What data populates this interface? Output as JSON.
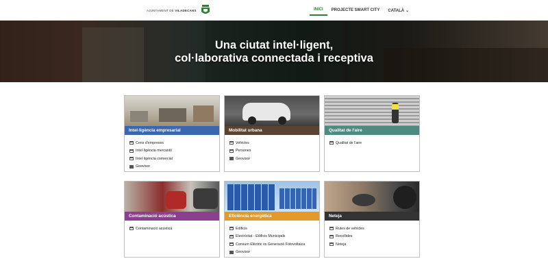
{
  "header": {
    "brand_prefix": "AJUNTAMENT DE",
    "brand_city": "VILADECANS",
    "nav": [
      {
        "label": "INICI"
      },
      {
        "label": "PROJECTE SMART CITY"
      },
      {
        "label": "CATALÀ"
      }
    ]
  },
  "hero": {
    "line1": "Una ciutat intel·ligent,",
    "line2": "col·laborativa connectada i receptiva"
  },
  "colors": {
    "accent_green": "#2e7d32",
    "card_blue": "#3a67b0",
    "card_brown": "#5b4332",
    "card_teal": "#4e8a80",
    "card_purple": "#8a3f8f",
    "card_orange": "#e39a2b",
    "card_dark": "#333333"
  },
  "cards": [
    {
      "title": "Intel·ligència empresarial",
      "items": [
        "Cens d'empreses",
        "Intel·ligència mercantil",
        "Intel·ligència comercial",
        "Geovisor"
      ]
    },
    {
      "title": "Mobilitat urbana",
      "items": [
        "Vehicles",
        "Persones",
        "Geovisor"
      ]
    },
    {
      "title": "Qualitat de l'aire",
      "items": [
        "Qualitat de l'aire"
      ]
    },
    {
      "title": "Contaminació acústica",
      "items": [
        "Contaminació acústica"
      ]
    },
    {
      "title": "Eficiència energètica",
      "items": [
        "Edificis",
        "Electricitat - Edificis Municipals",
        "Consum Elèctric vs Generació Fotovoltaica",
        "Geovisor"
      ]
    },
    {
      "title": "Neteja",
      "items": [
        "Rutes de vehicles",
        "Recollides",
        "Neteja"
      ]
    }
  ]
}
